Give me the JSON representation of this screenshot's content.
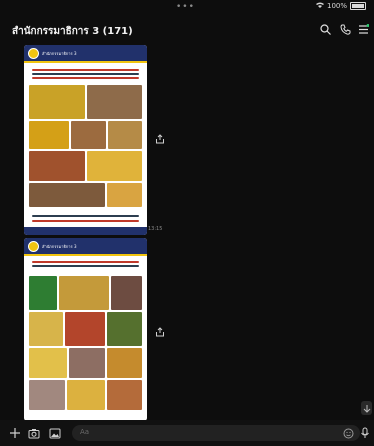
{
  "status_bar": {
    "battery": "100%"
  },
  "chat": {
    "title": "สำนักกรรมาธิการ 3 (171)"
  },
  "messages": [
    {
      "type": "image",
      "org": "สำนักกรรมาธิการ 3",
      "time": "13:15"
    },
    {
      "type": "image",
      "org": "สำนักกรรมาธิการ 3"
    }
  ],
  "input": {
    "placeholder": "Aa"
  },
  "icons": [
    "search-icon",
    "phone-icon",
    "menu-icon",
    "share-icon",
    "plus-icon",
    "camera-icon",
    "image-icon",
    "emoji-icon",
    "mic-icon",
    "scroll-down-icon"
  ]
}
